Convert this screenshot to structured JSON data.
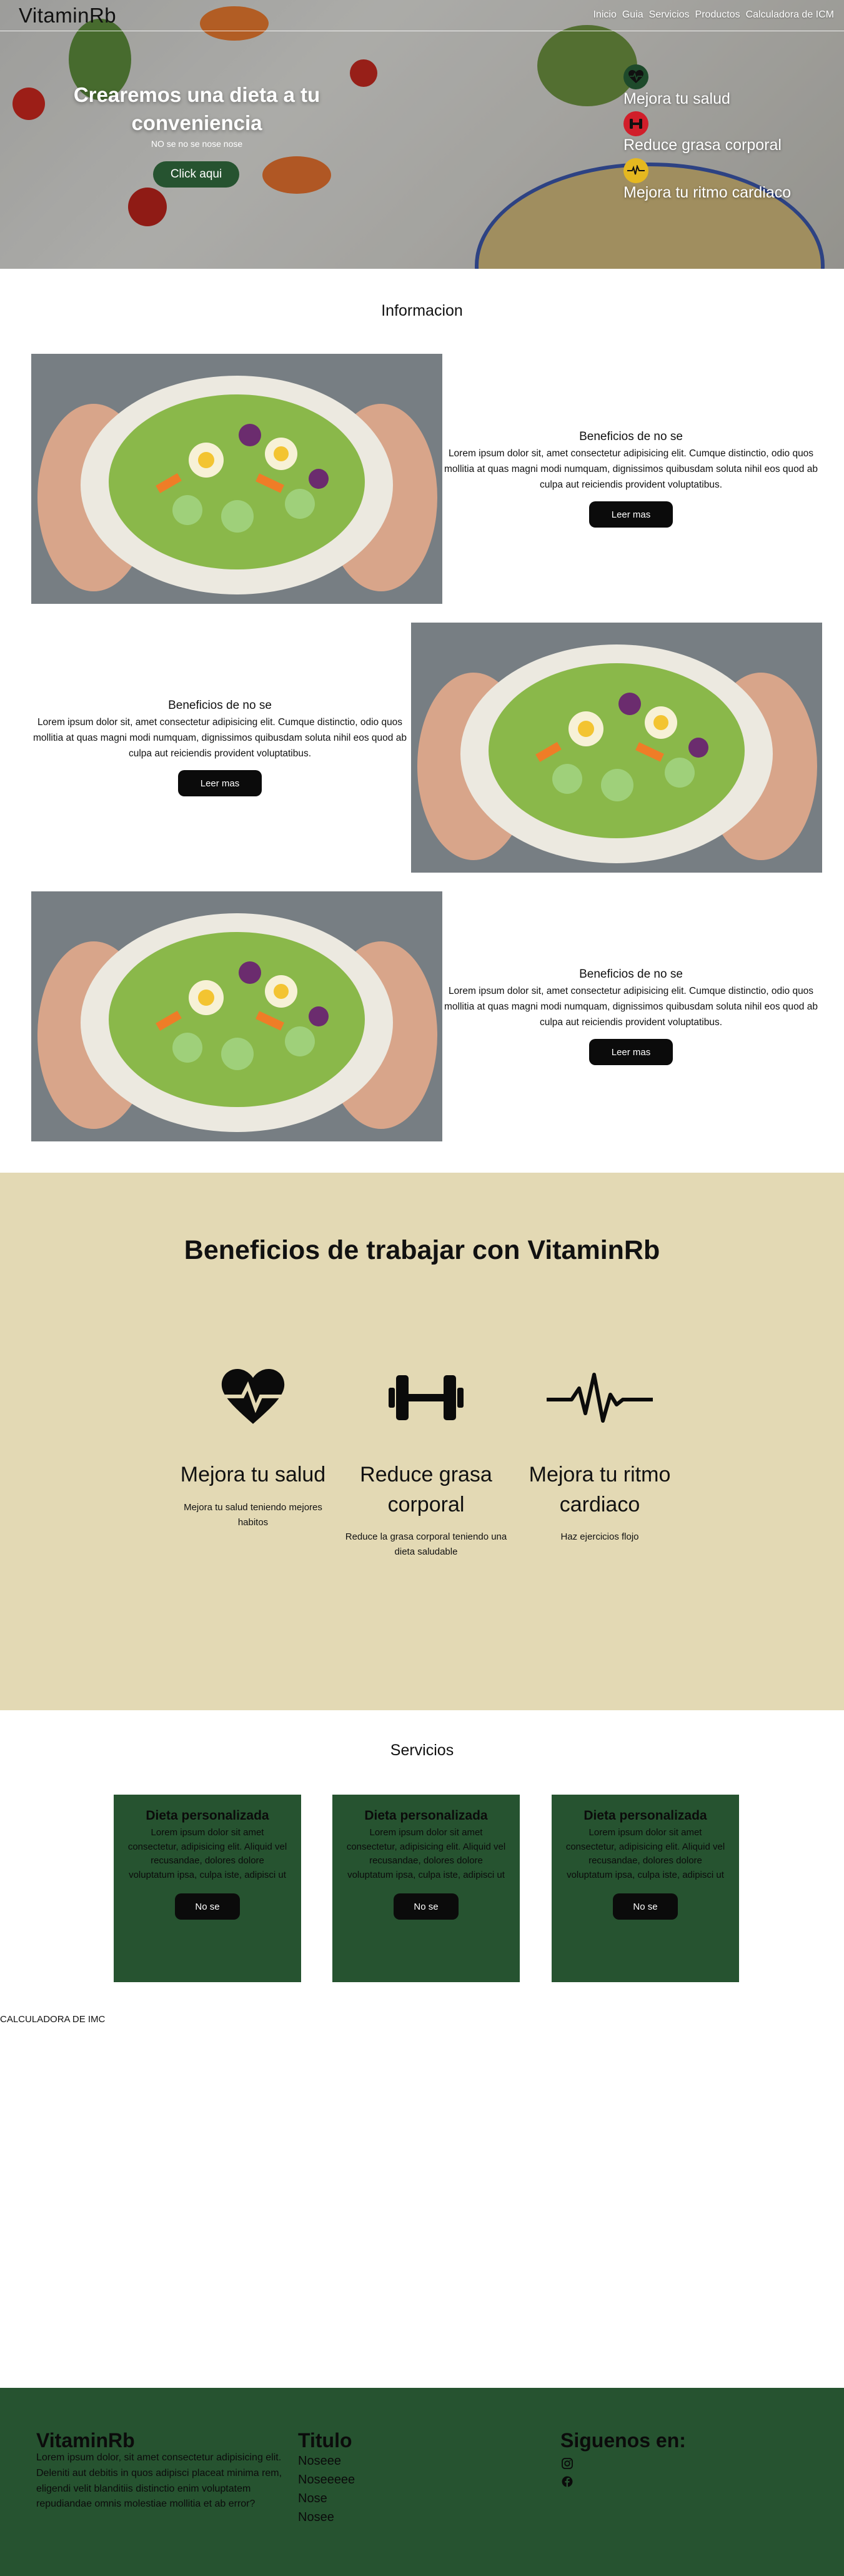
{
  "header": {
    "brand": "VitaminRb",
    "nav": [
      "Inicio",
      "Guia",
      "Servicios",
      "Productos",
      "Calculadora de ICM"
    ]
  },
  "hero": {
    "title": "Crearemos una dieta a tu conveniencia",
    "subtitle": "NO se no se nose nose",
    "button": "Click aqui",
    "features": [
      {
        "label": "Mejora tu salud",
        "icon": "heart-icon",
        "color": "#1e4a2b"
      },
      {
        "label": "Reduce grasa corporal",
        "icon": "dumbbell-icon",
        "color": "#d11e2a"
      },
      {
        "label": "Mejora tu ritmo cardiaco",
        "icon": "heartbeat-icon",
        "color": "#e5b820"
      }
    ]
  },
  "info": {
    "title": "Informacion",
    "items": [
      {
        "heading": "Beneficios de no se",
        "text": "Lorem ipsum dolor sit, amet consectetur adipisicing elit. Cumque distinctio, odio quos mollitia at quas magni modi numquam, dignissimos quibusdam soluta nihil eos quod ab culpa aut reiciendis provident voluptatibus.",
        "button": "Leer mas"
      },
      {
        "heading": "Beneficios de no se",
        "text": "Lorem ipsum dolor sit, amet consectetur adipisicing elit. Cumque distinctio, odio quos mollitia at quas magni modi numquam, dignissimos quibusdam soluta nihil eos quod ab culpa aut reiciendis provident voluptatibus.",
        "button": "Leer mas"
      },
      {
        "heading": "Beneficios de no se",
        "text": "Lorem ipsum dolor sit, amet consectetur adipisicing elit. Cumque distinctio, odio quos mollitia at quas magni modi numquam, dignissimos quibusdam soluta nihil eos quod ab culpa aut reiciendis provident voluptatibus.",
        "button": "Leer mas"
      }
    ]
  },
  "benefits": {
    "title": "Beneficios de trabajar con VitaminRb",
    "items": [
      {
        "title": "Mejora tu salud",
        "text": "Mejora tu salud teniendo mejores habitos",
        "icon": "heart-icon"
      },
      {
        "title": "Reduce grasa corporal",
        "text": "Reduce la grasa corporal teniendo una dieta saludable",
        "icon": "dumbbell-icon"
      },
      {
        "title": "Mejora tu ritmo cardiaco",
        "text": "Haz ejercicios flojo",
        "icon": "heartbeat-icon"
      }
    ]
  },
  "services": {
    "title": "Servicios",
    "cards": [
      {
        "title": "Dieta personalizada",
        "text": "Lorem ipsum dolor sit amet consectetur, adipisicing elit. Aliquid vel recusandae, dolores dolore voluptatum ipsa, culpa iste, adipisci ut",
        "button": "No se"
      },
      {
        "title": "Dieta personalizada",
        "text": "Lorem ipsum dolor sit amet consectetur, adipisicing elit. Aliquid vel recusandae, dolores dolore voluptatum ipsa, culpa iste, adipisci ut",
        "button": "No se"
      },
      {
        "title": "Dieta personalizada",
        "text": "Lorem ipsum dolor sit amet consectetur, adipisicing elit. Aliquid vel recusandae, dolores dolore voluptatum ipsa, culpa iste, adipisci ut",
        "button": "No se"
      }
    ]
  },
  "calculator": {
    "label": "CALCULADORA DE IMC"
  },
  "footer": {
    "brand": "VitaminRb",
    "description": "Lorem ipsum dolor, sit amet consectetur adipisicing elit. Deleniti aut debitis in quos adipisci placeat minima rem, eligendi velit blanditiis distinctio enim voluptatem repudiandae omnis molestiae mollitia et ab error?",
    "links_title": "Titulo",
    "links": [
      "Noseee",
      "Noseeeee",
      "Nose",
      "Nosee"
    ],
    "social_title": "Siguenos en:",
    "social": [
      {
        "icon": "instagram-icon"
      },
      {
        "icon": "facebook-icon"
      }
    ]
  },
  "colors": {
    "primary_green": "#265330",
    "beige": "#e3d9b4",
    "black": "#0b0b0b"
  }
}
